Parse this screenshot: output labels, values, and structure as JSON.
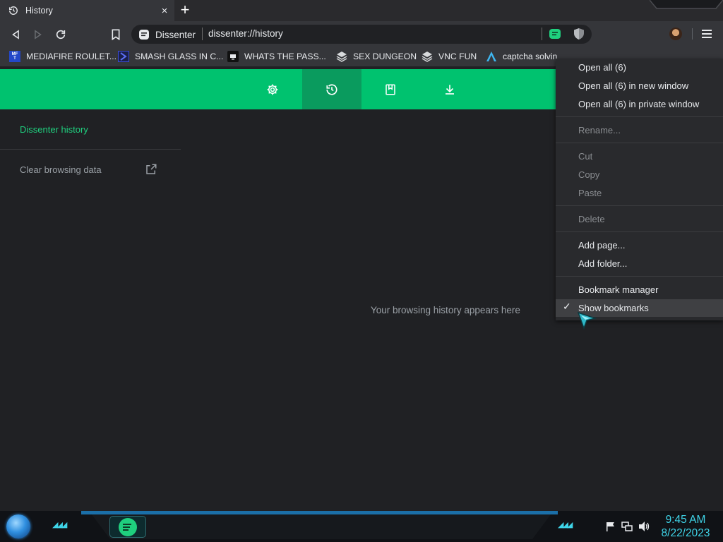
{
  "tab": {
    "title": "History",
    "close_glyph": "×",
    "new_tab_glyph": "+"
  },
  "omnibox": {
    "site_name": "Dissenter",
    "url": "dissenter://history"
  },
  "bookmarks": [
    {
      "label": "MEDIAFIRE ROULET...",
      "icon": "mediafire-icon"
    },
    {
      "label": "SMASH GLASS IN C...",
      "icon": "chevron-bookmark-icon"
    },
    {
      "label": "WHATS THE PASS...",
      "icon": "monitor-bookmark-icon"
    },
    {
      "label": "SEX DUNGEON",
      "icon": "vnc-bookmark-icon"
    },
    {
      "label": "VNC FUN",
      "icon": "vnc-bookmark-icon"
    },
    {
      "label": "captcha solvin",
      "icon": "arch-bookmark-icon"
    }
  ],
  "mediafire_icon_text": "MF\nT",
  "sidebar": {
    "title": "Dissenter history",
    "clear_label": "Clear browsing data"
  },
  "main": {
    "empty_message": "Your browsing history appears here"
  },
  "context_menu": {
    "open_all": "Open all (6)",
    "open_all_new_window": "Open all (6) in new window",
    "open_all_private": "Open all (6) in private window",
    "rename": "Rename...",
    "cut": "Cut",
    "copy": "Copy",
    "paste": "Paste",
    "delete": "Delete",
    "add_page": "Add page...",
    "add_folder": "Add folder...",
    "bookmark_manager": "Bookmark manager",
    "show_bookmarks": "Show bookmarks",
    "check_glyph": "✓"
  },
  "taskbar": {
    "time": "9:45 AM",
    "date": "8/22/2023",
    "chevrons": "◢◢◢"
  },
  "colors": {
    "accent_green": "#00c26f",
    "active_green": "#0a9b5e",
    "taskbar_cyan": "#3fd4e8"
  }
}
